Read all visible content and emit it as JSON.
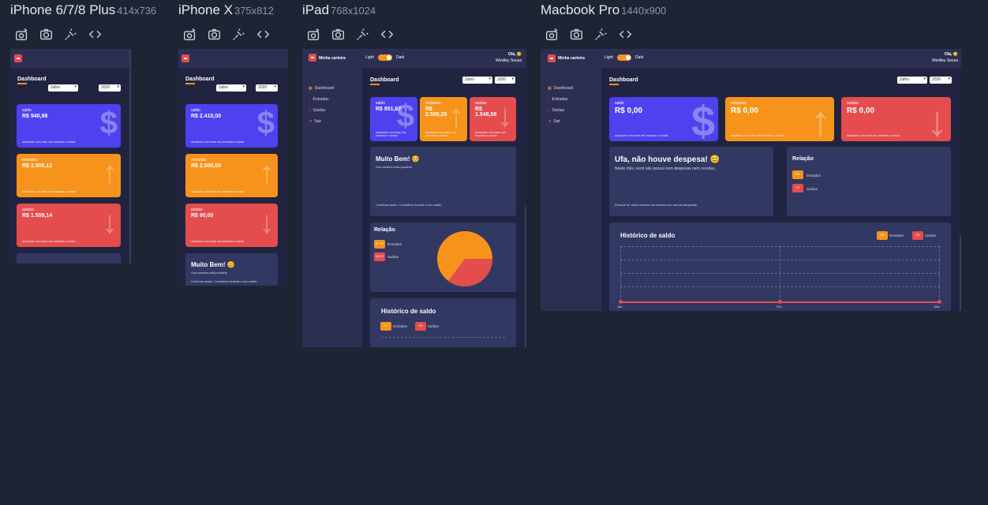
{
  "devices": [
    {
      "name": "iPhone 6/7/8 Plus",
      "dims": "414x736"
    },
    {
      "name": "iPhone X",
      "dims": "375x812"
    },
    {
      "name": "iPad",
      "dims": "768x1024"
    },
    {
      "name": "Macbook Pro",
      "dims": "1440x900"
    }
  ],
  "app": {
    "logo_text": "Minha carteira",
    "title": "Dashboard",
    "month": "Julho",
    "year": "2020",
    "theme_light": "Light",
    "theme_dark": "Dark",
    "greeting": "Olá, 😊",
    "user": "Weslley Sousa",
    "menu": [
      "Dashboard",
      "Entradas",
      "Saídas",
      "Sair"
    ]
  },
  "cards": {
    "saldo_label": "saldo",
    "entradas_label": "entradas",
    "saidas_label": "saídas",
    "iphone_plus": {
      "saldo": "R$ 940,98",
      "entradas": "R$ 2.500,12",
      "saidas": "R$ 1.559,14"
    },
    "iphone_x": {
      "saldo": "R$ 2.410,00",
      "entradas": "R$ 2.500,00",
      "saidas": "R$ 90,00"
    },
    "ipad": {
      "saldo": "R$ 951,67",
      "entradas": "R$ 2.500,25",
      "saidas": "R$ 1.548,58"
    },
    "mac": {
      "saldo": "R$ 0,00",
      "entradas": "R$ 0,00",
      "saidas": "R$ 0,00"
    },
    "foot_saldo": "atualizado com base nas entradas e saídas",
    "foot_entradas": "atualizado com base nas entradas e saídas",
    "foot_saidas": "atualizado com base nas entradas e saídas"
  },
  "messages": {
    "good_title": "Muito Bem! 😊",
    "good_sub": "Sua carteira está positiva!",
    "good_foot": "Continue assim. Considere investir o seu saldo.",
    "none_title": "Ufa, não houve despesa! 😊",
    "none_sub": "Neste mês, você não possui nem despesas nem receitas.",
    "none_foot": "Procure ter mais receitas em meses com menos despesas."
  },
  "relacao": {
    "title": "Relação",
    "entradas_pct": "61.8%",
    "saidas_pct": "38.2%",
    "mac_entradas_pct": "0%",
    "mac_saidas_pct": "0%",
    "entradas": "Entradas",
    "saidas": "Saídas",
    "colors": {
      "entradas": "#f7931b",
      "saidas": "#e44c4e"
    }
  },
  "historico": {
    "title": "Histórico de saldo",
    "entradas_pct": "0%",
    "saidas_pct": "0%",
    "entradas": "Entradas",
    "saidas": "Saídas",
    "x_labels": [
      "Jan",
      "Fev",
      "Mar"
    ]
  },
  "colors": {
    "bg": "#1d2535",
    "screen": "#212441",
    "blue": "#4e41f0",
    "orange": "#f7931b",
    "red": "#e44c4e"
  }
}
